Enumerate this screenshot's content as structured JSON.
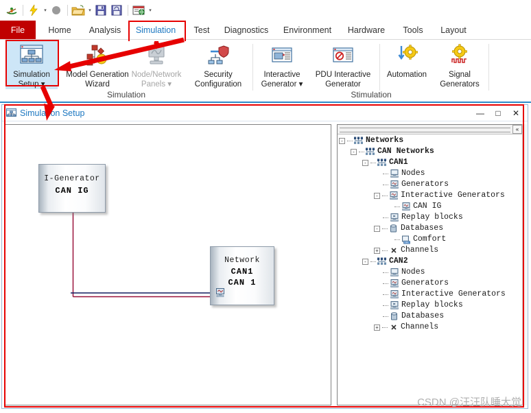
{
  "quick_access": {
    "items": [
      {
        "name": "canoe-logo-icon",
        "label": "CANoe"
      },
      {
        "name": "start-measurement-icon",
        "label": "Start"
      },
      {
        "name": "start-dropdown-caret",
        "label": "▾"
      },
      {
        "name": "stop-measurement-icon",
        "label": "Stop"
      },
      {
        "name": "open-folder-icon",
        "label": "Open"
      },
      {
        "name": "open-dropdown-caret",
        "label": "▾"
      },
      {
        "name": "save-icon",
        "label": "Save"
      },
      {
        "name": "save-all-icon",
        "label": "Save All"
      },
      {
        "name": "print-preview-icon",
        "label": "Print"
      },
      {
        "name": "customize-qat-caret",
        "label": "▾"
      }
    ]
  },
  "ribbon": {
    "tabs": [
      {
        "label": "File",
        "active": false,
        "style": "file"
      },
      {
        "label": "Home",
        "active": false
      },
      {
        "label": "Analysis",
        "active": false
      },
      {
        "label": "Simulation",
        "active": true
      },
      {
        "label": "Test",
        "active": false
      },
      {
        "label": "Diagnostics",
        "active": false
      },
      {
        "label": "Environment",
        "active": false
      },
      {
        "label": "Hardware",
        "active": false
      },
      {
        "label": "Tools",
        "active": false
      },
      {
        "label": "Layout",
        "active": false
      }
    ],
    "groups": [
      {
        "label": "Simulation"
      },
      {
        "label": "Stimulation"
      }
    ],
    "buttons": [
      {
        "name": "simulation-setup",
        "line1": "Simulation",
        "line2": "Setup ▾",
        "icon": "simulation-setup-icon",
        "state": "selected"
      },
      {
        "name": "model-generation-wizard",
        "line1": "Model Generation",
        "line2": "Wizard",
        "icon": "model-generation-wizard-icon",
        "state": "normal"
      },
      {
        "name": "node-network-panels",
        "line1": "Node/Network",
        "line2": "Panels ▾",
        "icon": "node-network-panels-icon",
        "state": "disabled"
      },
      {
        "name": "security-configuration",
        "line1": "Security",
        "line2": "Configuration",
        "icon": "security-configuration-icon",
        "state": "normal"
      },
      {
        "name": "interactive-generator",
        "line1": "Interactive",
        "line2": "Generator ▾",
        "icon": "interactive-generator-icon",
        "state": "normal"
      },
      {
        "name": "pdu-interactive-generator",
        "line1": "PDU Interactive",
        "line2": "Generator",
        "icon": "pdu-interactive-generator-icon",
        "state": "normal"
      },
      {
        "name": "automation",
        "line1": "Automation",
        "line2": "",
        "icon": "automation-icon",
        "state": "normal"
      },
      {
        "name": "signal-generators",
        "line1": "Signal",
        "line2": "Generators",
        "icon": "signal-generators-icon",
        "state": "normal"
      }
    ]
  },
  "window": {
    "title": "Simulation Setup",
    "icon": "simulation-setup-icon",
    "controls": [
      {
        "name": "minimize-button",
        "glyph": "—"
      },
      {
        "name": "maximize-button",
        "glyph": "□"
      },
      {
        "name": "close-button",
        "glyph": "✕"
      }
    ]
  },
  "canvas": {
    "nodes": [
      {
        "name": "igenerator-block",
        "line1": "I-Generator",
        "line2": "CAN IG",
        "line3": "",
        "icon": ""
      },
      {
        "name": "network-block",
        "line1": "Network",
        "line2": "CAN1",
        "line3": "CAN  1",
        "icon": "bus-icon"
      }
    ]
  },
  "tree": {
    "collapse_glyph": "«",
    "items": [
      {
        "label": "Networks",
        "indent": 0,
        "toggle": "-",
        "icon": "network-cluster-icon",
        "bold": true
      },
      {
        "label": "CAN Networks",
        "indent": 1,
        "toggle": "-",
        "icon": "network-cluster-icon",
        "bold": true
      },
      {
        "label": "CAN1",
        "indent": 2,
        "toggle": "-",
        "icon": "network-cluster-icon",
        "bold": true
      },
      {
        "label": "Nodes",
        "indent": 3,
        "toggle": "",
        "icon": "node-icon",
        "bold": false
      },
      {
        "label": "Generators",
        "indent": 3,
        "toggle": "",
        "icon": "generator-icon",
        "bold": false
      },
      {
        "label": "Interactive Generators",
        "indent": 3,
        "toggle": "-",
        "icon": "generator-icon",
        "bold": false
      },
      {
        "label": "CAN IG",
        "indent": 4,
        "toggle": "",
        "icon": "generator-icon",
        "bold": false
      },
      {
        "label": "Replay blocks",
        "indent": 3,
        "toggle": "",
        "icon": "replay-icon",
        "bold": false
      },
      {
        "label": "Databases",
        "indent": 3,
        "toggle": "-",
        "icon": "database-icon",
        "bold": false
      },
      {
        "label": "Comfort",
        "indent": 4,
        "toggle": "",
        "icon": "dbc-icon",
        "bold": false
      },
      {
        "label": "Channels",
        "indent": 3,
        "toggle": "+",
        "icon": "channel-icon",
        "bold": false
      },
      {
        "label": "CAN2",
        "indent": 2,
        "toggle": "-",
        "icon": "network-cluster-icon",
        "bold": true
      },
      {
        "label": "Nodes",
        "indent": 3,
        "toggle": "",
        "icon": "node-icon",
        "bold": false
      },
      {
        "label": "Generators",
        "indent": 3,
        "toggle": "",
        "icon": "generator-icon",
        "bold": false
      },
      {
        "label": "Interactive Generators",
        "indent": 3,
        "toggle": "",
        "icon": "generator-icon",
        "bold": false
      },
      {
        "label": "Replay blocks",
        "indent": 3,
        "toggle": "",
        "icon": "replay-icon",
        "bold": false
      },
      {
        "label": "Databases",
        "indent": 3,
        "toggle": "",
        "icon": "database-icon",
        "bold": false
      },
      {
        "label": "Channels",
        "indent": 3,
        "toggle": "+",
        "icon": "channel-icon",
        "bold": false
      }
    ]
  },
  "annotations": {
    "color": "#e60000",
    "boxes": [
      "simulation-tab-highlight",
      "simulation-setup-button-highlight",
      "simulation-setup-window-highlight"
    ],
    "arrows": [
      "arrow-to-simulation-setup-button",
      "arrow-to-simulation-setup-window"
    ]
  },
  "watermark": {
    "text": "CSDN @汪汪队睡大觉"
  },
  "colors": {
    "file_tab": "#c00000",
    "active_tab_text": "#1d78c1",
    "ribbon_rule": "#2e8bc9",
    "annotation": "#e60000",
    "link_navy": "#101a5e",
    "link_maroon": "#99113a"
  }
}
